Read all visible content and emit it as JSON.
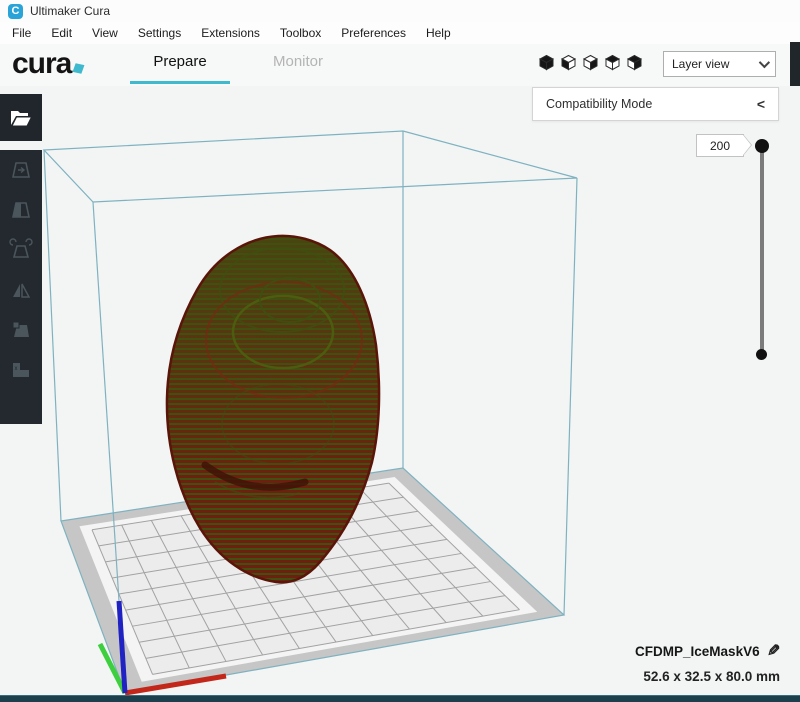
{
  "window": {
    "title": "Ultimaker Cura"
  },
  "menu": {
    "items": [
      "File",
      "Edit",
      "View",
      "Settings",
      "Extensions",
      "Toolbox",
      "Preferences",
      "Help"
    ]
  },
  "header": {
    "logo_text": "cura",
    "tab_prepare": "Prepare",
    "tab_monitor": "Monitor"
  },
  "view_bar": {
    "modes": [
      "3d-view",
      "front-view",
      "top-view",
      "left-view",
      "right-view"
    ],
    "dropdown_value": "Layer view"
  },
  "panels": {
    "compatibility_label": "Compatibility Mode",
    "collapse_chevron": "<"
  },
  "layer_slider": {
    "value": "200"
  },
  "toolbar": {
    "tools": [
      "move",
      "scale",
      "rotate",
      "mirror",
      "per-model-settings",
      "mesh-type"
    ]
  },
  "model": {
    "name": "CFDMP_IceMaskV6",
    "dimensions": "52.6 x 32.5 x 80.0 mm"
  },
  "colors": {
    "accent": "#3fb9cd",
    "volume_line": "#7fb2c0",
    "plate_border": "#c6c6c6",
    "plate_band": "#f4f4f4",
    "plate_inner": "#ececec",
    "plate_grid": "#a2a2a2",
    "model_red": "#6e1f0f",
    "model_green": "#3f5010",
    "model_outline": "#5a1509",
    "model_dark": "#3f1206",
    "axis_x": "#c2271a",
    "axis_y": "#3ecf3e",
    "axis_z": "#2023c2",
    "toolbar_icon": "#4a555c",
    "bottom_bar": "#1c3f4e"
  }
}
